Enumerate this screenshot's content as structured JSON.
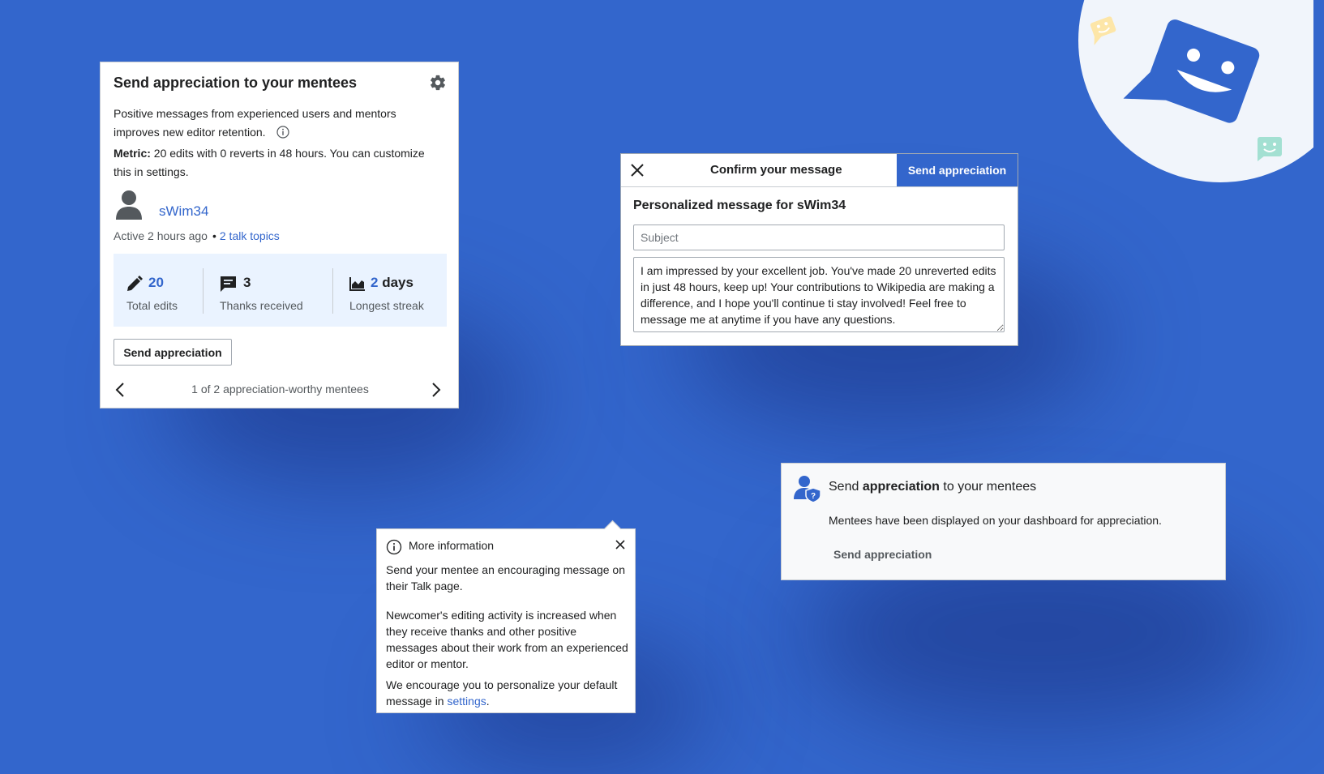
{
  "mentees_card": {
    "title": "Send appreciation to your mentees",
    "description": "Positive messages from experienced users and mentors improves new editor retention.",
    "metric_label": "Metric:",
    "metric_edits": "20",
    "metric_text_1": " edits with ",
    "metric_reverts": "0",
    "metric_text_2": " reverts in ",
    "metric_hours": "48",
    "metric_text_3": " hours. You can customize this in settings.",
    "username": "sWim34",
    "active": "Active 2 hours ago",
    "separator": "•",
    "talk_topics": "2 talk topics",
    "stats": {
      "edits_value": "20",
      "edits_label": "Total edits",
      "thanks_value": "3",
      "thanks_label": "Thanks received",
      "streak_number": "2",
      "streak_unit": "days",
      "streak_label": "Longest streak"
    },
    "send_button": "Send appreciation",
    "pager_text": "1 of 2 appreciation-worthy mentees"
  },
  "confirm_dialog": {
    "title": "Confirm your message",
    "primary_button": "Send appreciation",
    "label": "Personalized message for sWim34",
    "subject_placeholder": "Subject",
    "message": "I am impressed by your excellent job. You've made 20 unreverted edits in just 48 hours, keep up! Your contributions to Wikipedia are making a difference, and I hope you'll continue ti stay involved! Feel free to message me at anytime if you have any questions."
  },
  "info_popup": {
    "title": "More information",
    "p1": "Send your mentee an encouraging message on their Talk page.",
    "p2": "Newcomer's editing activity is increased when they receive thanks and other positive messages about their work from an experienced editor or mentor.",
    "p3_prefix": "We encourage you to personalize your default message in ",
    "p3_link": "settings",
    "p3_suffix": "."
  },
  "notice": {
    "title_prefix": "Send ",
    "title_bold": "appreciation",
    "title_suffix": " to your mentees",
    "text": "Mentees have been displayed on your dashboard for appreciation.",
    "action": "Send appreciation"
  },
  "colors": {
    "background": "#3366cc",
    "accent": "#3366cc",
    "stats_bg": "#eaf3ff",
    "notice_bg": "#f8f9fa"
  }
}
